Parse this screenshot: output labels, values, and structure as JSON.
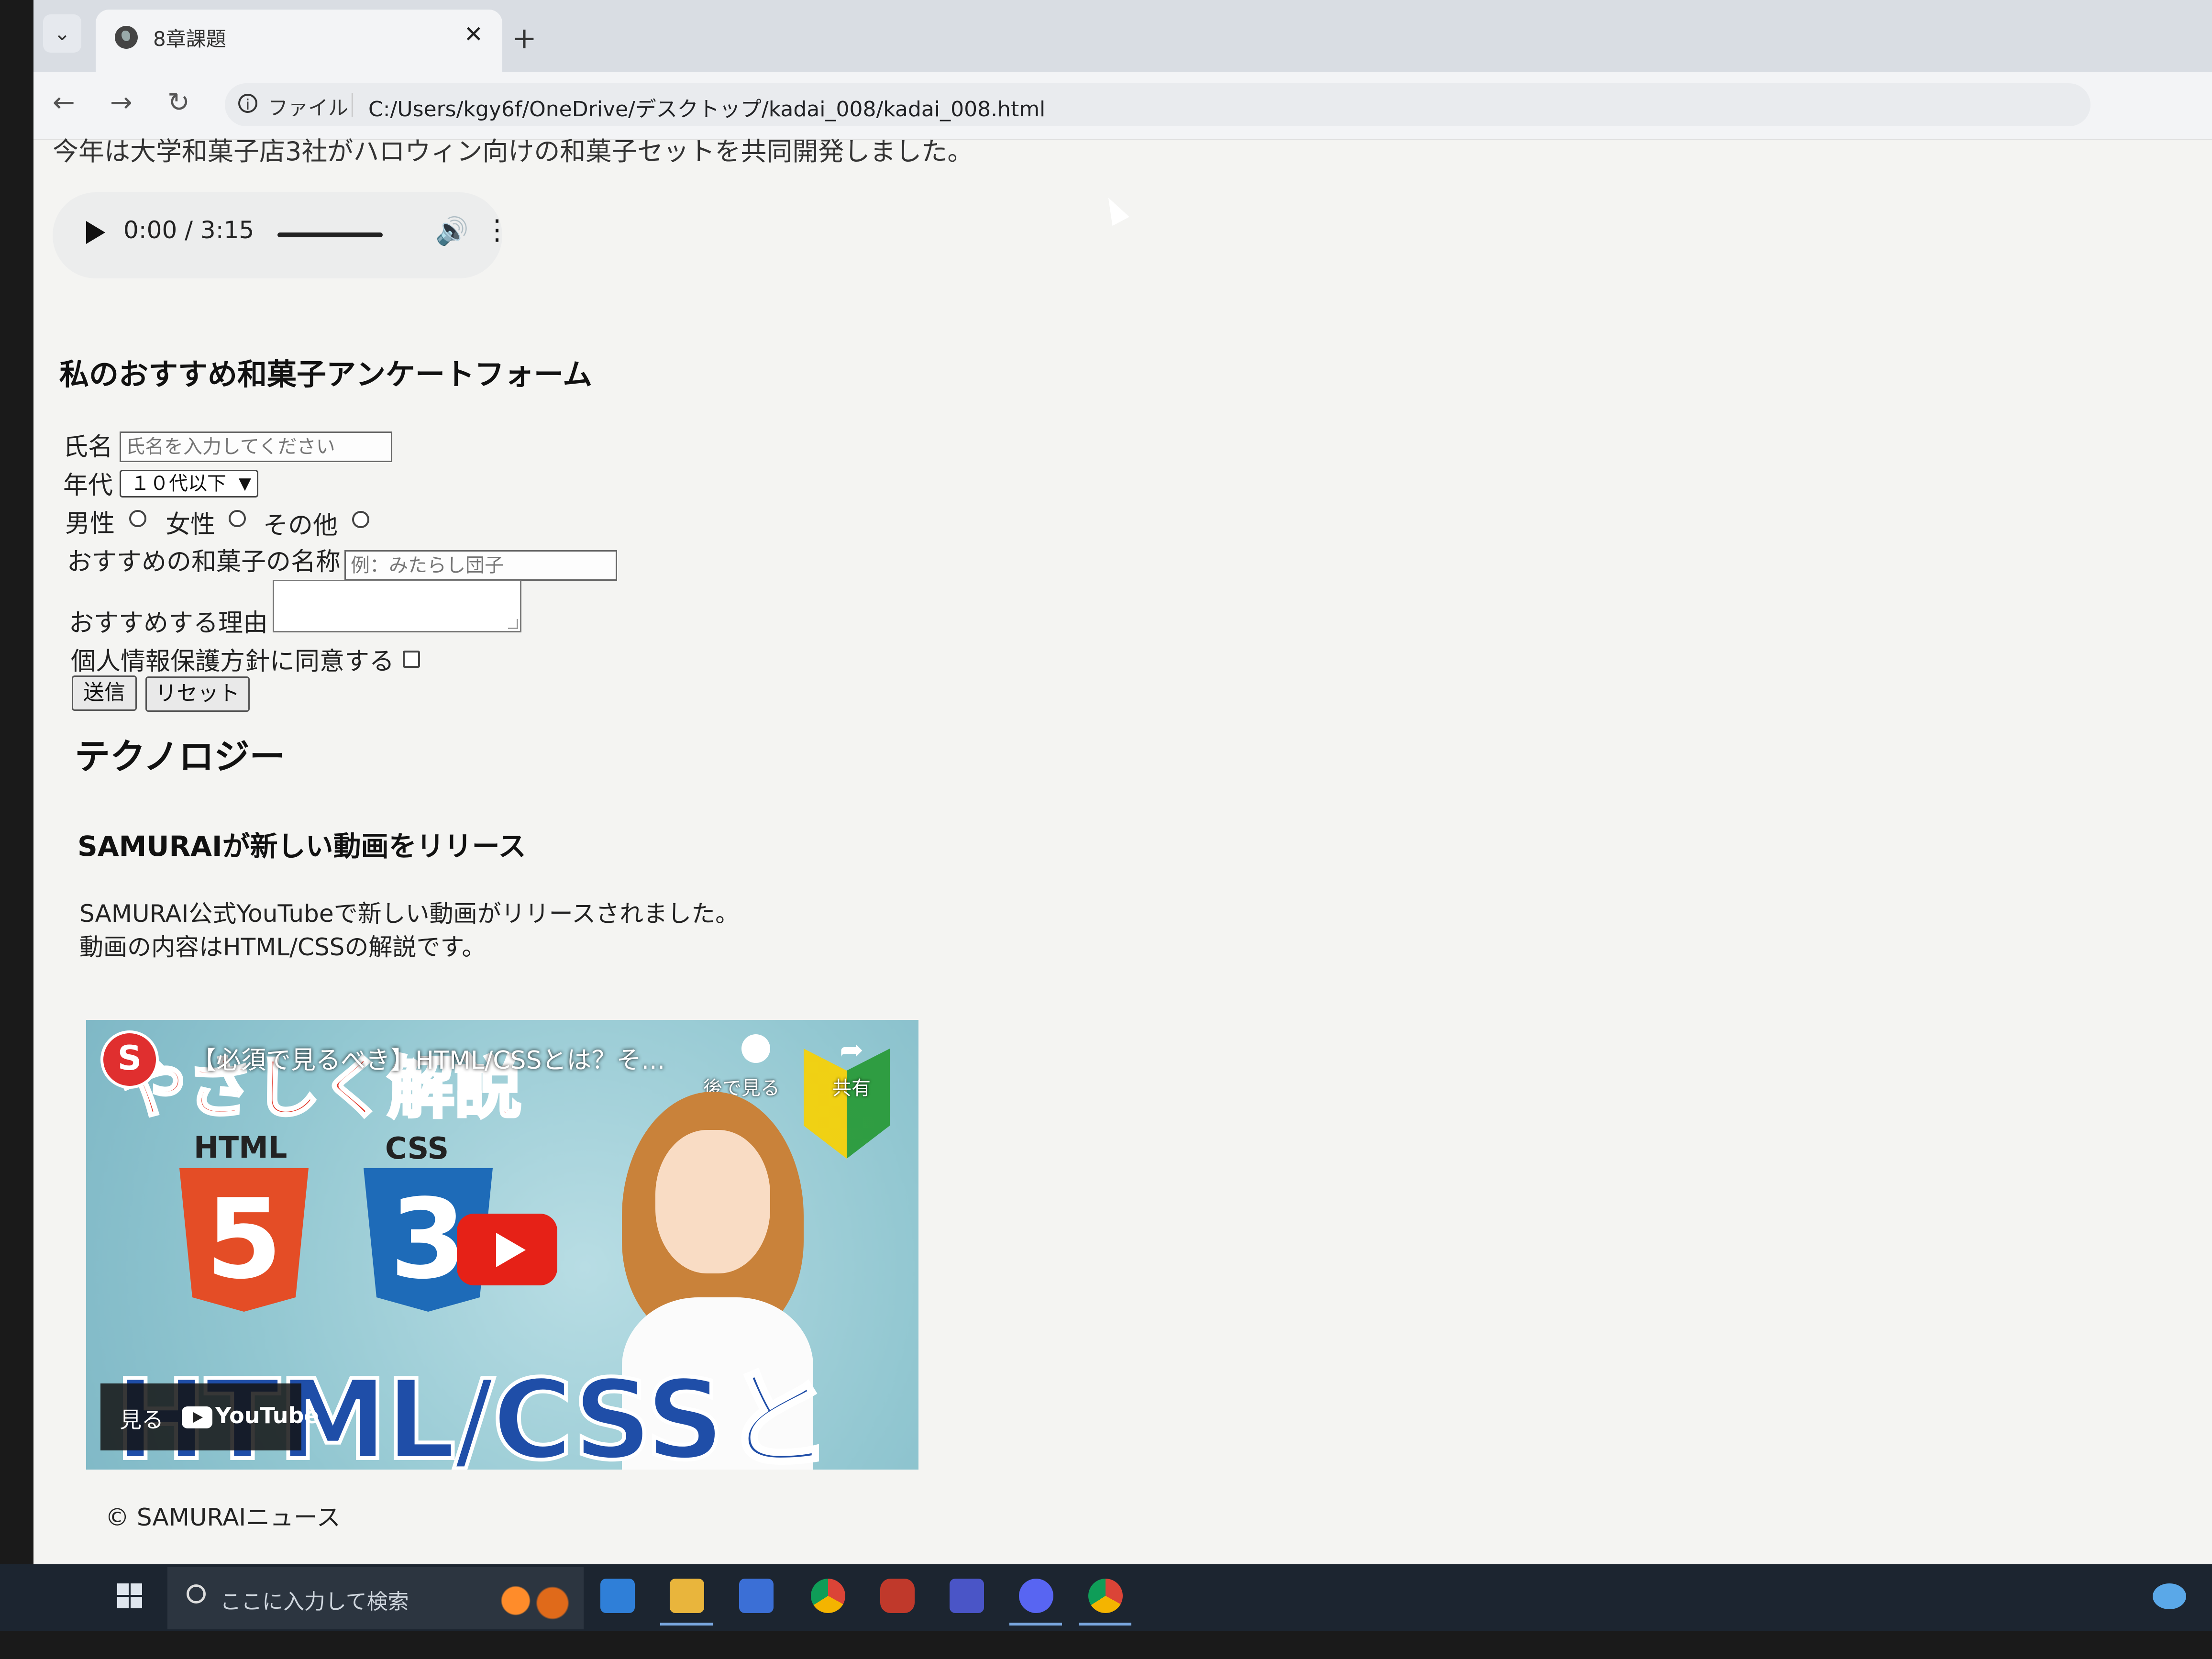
{
  "browser": {
    "tab_title": "8章課題",
    "tab_close": "✕",
    "new_tab": "+",
    "scheme_label": "ファイル",
    "url": "C:/Users/kgy6f/OneDrive/デスクトップ/kadai_008/kadai_008.html"
  },
  "page": {
    "cut_off_text": "今年は大学和菓子店3社がハロウィン向けの和菓子セットを共同開発しました。",
    "audio": {
      "time": "0:00 / 3:15"
    },
    "form": {
      "title": "私のおすすめ和菓子アンケートフォーム",
      "name_label": "氏名",
      "name_placeholder": "氏名を入力してください",
      "age_label": "年代",
      "age_selected": "１０代以下",
      "gender_options": [
        "男性",
        "女性",
        "その他"
      ],
      "wagashi_label": "おすすめの和菓子の名称",
      "wagashi_placeholder": "例：みたらし団子",
      "reason_label": "おすすめする理由",
      "consent_label": "個人情報保護方針に同意する",
      "submit_label": "送信",
      "reset_label": "リセット"
    },
    "tech": {
      "heading": "テクノロジー",
      "article_title": "SAMURAIが新しい動画をリリース",
      "article_lines": [
        "SAMURAI公式YouTubeで新しい動画がリリースされました。",
        "動画の内容はHTML/CSSの解説です。"
      ]
    },
    "video": {
      "banner": "やさしく解説",
      "title": "【必須で見るべき】HTML/CSSとは？そ...",
      "watch_later": "後で見る",
      "share": "共有",
      "html_label": "HTML",
      "css_label": "CSS",
      "html_badge": "5",
      "css_badge": "3",
      "big_text": "HTML/CSSとは？",
      "watch_on": "見る",
      "youtube": "YouTube"
    },
    "copyright": "© SAMURAIニュース"
  },
  "taskbar": {
    "search_placeholder": "ここに入力して検索"
  },
  "colors": {
    "youtube_red": "#e62117",
    "html5_orange": "#e44d26",
    "css3_blue": "#1e6bb8"
  }
}
